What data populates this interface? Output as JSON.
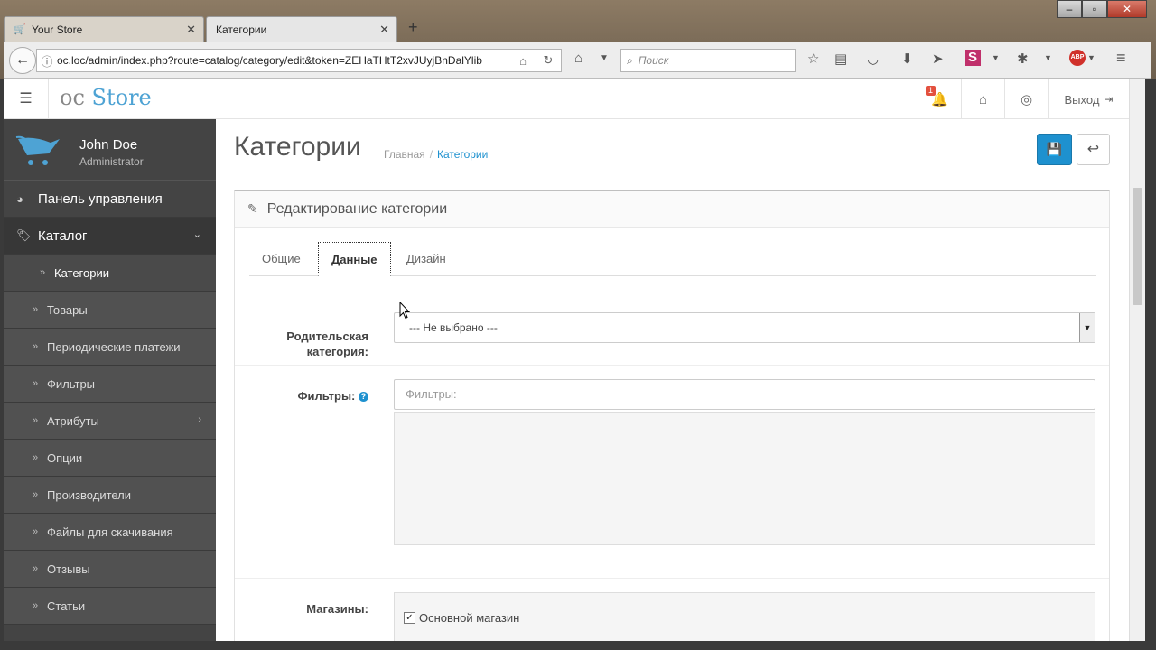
{
  "browser": {
    "tabs": [
      {
        "label": "Your Store",
        "active": false
      },
      {
        "label": "Категории",
        "active": true
      }
    ],
    "url": "oc.loc/admin/index.php?route=catalog/category/edit&token=ZEHaTHtT2xvJUyjBnDalYlib",
    "search_placeholder": "Поиск"
  },
  "header": {
    "logo_prefix": "oc",
    "logo_brand": "Store",
    "notification_count": "1",
    "logout_label": "Выход"
  },
  "profile": {
    "name": "John Doe",
    "role": "Administrator"
  },
  "sidebar": {
    "dashboard": "Панель управления",
    "catalog": "Каталог",
    "items": [
      "Категории",
      "Товары",
      "Периодические платежи",
      "Фильтры",
      "Атрибуты",
      "Опции",
      "Производители",
      "Файлы для скачивания",
      "Отзывы",
      "Статьи"
    ]
  },
  "page": {
    "title": "Категории",
    "breadcrumb_home": "Главная",
    "breadcrumb_current": "Категории",
    "panel_title": "Редактирование категории"
  },
  "tabs": {
    "general": "Общие",
    "data": "Данные",
    "design": "Дизайн"
  },
  "form": {
    "parent_label_1": "Родительская",
    "parent_label_2": "категория:",
    "parent_value": "--- Не выбрано ---",
    "filters_label": "Фильтры:",
    "filters_placeholder": "Фильтры:",
    "stores_label": "Магазины:",
    "store_default": "Основной магазин"
  },
  "colors": {
    "accent": "#1e91cf",
    "sidebar": "#444444",
    "badge": "#e3503e"
  }
}
